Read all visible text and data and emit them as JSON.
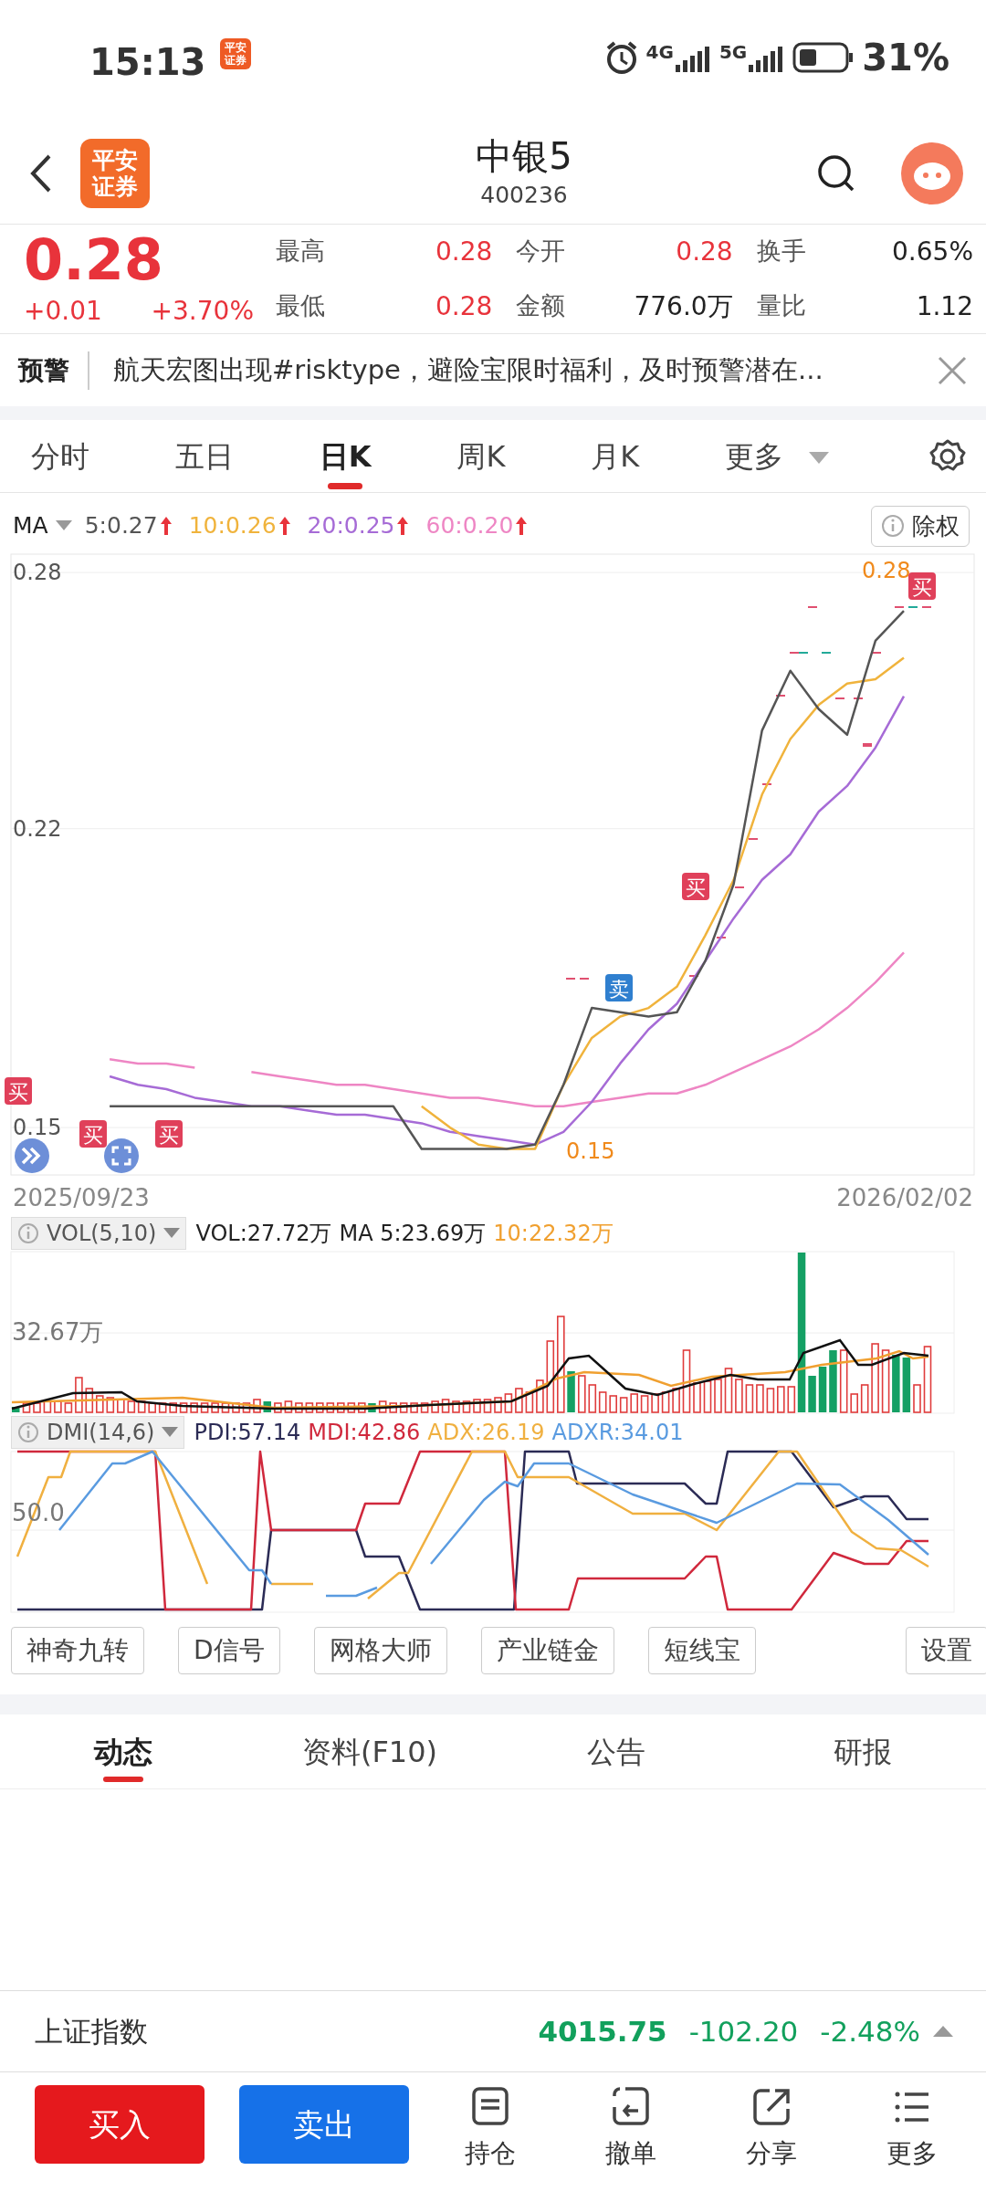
{
  "status_bar": {
    "time": "15:13",
    "app_badge": [
      "平安",
      "证券"
    ],
    "network_1": "4G",
    "network_2": "5G",
    "battery": "31%"
  },
  "header": {
    "logo": [
      "平安",
      "证券"
    ],
    "title": "中银5",
    "code": "400236"
  },
  "quote": {
    "price": "0.28",
    "change": "+0.01",
    "change_pct": "+3.70%",
    "stats": [
      {
        "label": "最高",
        "value": "0.28",
        "kind": "up"
      },
      {
        "label": "今开",
        "value": "0.28",
        "kind": "up"
      },
      {
        "label": "换手",
        "value": "0.65%",
        "kind": "plain"
      },
      {
        "label": "最低",
        "value": "0.28",
        "kind": "up"
      },
      {
        "label": "金额",
        "value": "776.0万",
        "kind": "plain"
      },
      {
        "label": "量比",
        "value": "1.12",
        "kind": "plain"
      }
    ]
  },
  "alert": {
    "label": "预警",
    "text": "航天宏图出现#risktype，避险宝限时福利，及时预警潜在..."
  },
  "period_tabs": [
    {
      "label": "分时",
      "selected": false,
      "kind": "plain"
    },
    {
      "label": "五日",
      "selected": false,
      "kind": "plain"
    },
    {
      "label": "日K",
      "selected": true,
      "kind": "plain"
    },
    {
      "label": "周K",
      "selected": false,
      "kind": "plain"
    },
    {
      "label": "月K",
      "selected": false,
      "kind": "plain"
    },
    {
      "label": "更多",
      "selected": false,
      "kind": "dropdown"
    }
  ],
  "ma_legend": {
    "label": "MA",
    "button": "除权",
    "items": [
      {
        "text": "5:0.27",
        "color": "#555555"
      },
      {
        "text": "10:0.26",
        "color": "#f0b33c"
      },
      {
        "text": "20:0.25",
        "color": "#a66bd6"
      },
      {
        "text": "60:0.20",
        "color": "#ee86c4"
      }
    ]
  },
  "price_chart": {
    "chart_data": {
      "type": "line",
      "categories": [
        "2025/09/23",
        null,
        null,
        null,
        null,
        null,
        null,
        null,
        null,
        null,
        null,
        null,
        null,
        null,
        null,
        null,
        null,
        null,
        null,
        null,
        null,
        null,
        null,
        null,
        null,
        null,
        null,
        null,
        null,
        "2026/02/02"
      ],
      "ylim": [
        0.1389,
        0.2843
      ],
      "yticks": [
        0.28,
        0.22,
        0.15
      ],
      "grid": true,
      "series": [
        {
          "color": "#ee86c4",
          "values": [
            null,
            0.166,
            0.165,
            0.165,
            0.164,
            null,
            0.163,
            0.162,
            0.161,
            0.16,
            0.16,
            0.159,
            0.158,
            0.157,
            0.157,
            0.156,
            0.155,
            0.155,
            0.156,
            0.157,
            0.158,
            0.158,
            0.16,
            0.163,
            0.166,
            0.169,
            0.173,
            0.178,
            0.184,
            0.191
          ]
        },
        {
          "color": "#a66bd6",
          "values": [
            null,
            0.162,
            0.16,
            0.159,
            0.157,
            0.156,
            0.155,
            0.155,
            0.154,
            0.153,
            0.153,
            0.152,
            0.151,
            0.149,
            0.148,
            0.147,
            0.146,
            0.149,
            0.156,
            0.165,
            0.173,
            0.179,
            0.189,
            0.199,
            0.208,
            0.214,
            0.224,
            0.23,
            0.239,
            0.251
          ]
        },
        {
          "color": "#f0b33c",
          "values": [
            null,
            null,
            null,
            null,
            null,
            null,
            null,
            null,
            null,
            null,
            null,
            null,
            0.155,
            0.15,
            0.146,
            0.145,
            0.145,
            0.16,
            0.171,
            0.176,
            0.178,
            0.183,
            0.195,
            0.208,
            0.228,
            0.241,
            0.249,
            0.254,
            0.255,
            0.26
          ]
        },
        {
          "color": "#555555",
          "values": [
            null,
            0.155,
            0.155,
            0.155,
            0.155,
            0.155,
            0.155,
            0.155,
            0.155,
            0.155,
            0.155,
            0.155,
            0.145,
            0.145,
            0.145,
            0.145,
            0.146,
            0.16,
            0.178,
            0.177,
            0.176,
            0.177,
            0.189,
            0.207,
            0.243,
            0.257,
            0.248,
            0.242,
            0.264,
            0.271
          ]
        }
      ]
    },
    "high_label": "0.28",
    "low_label": "0.15",
    "markers": [
      {
        "text": "买",
        "kind": "buy"
      },
      {
        "text": "买",
        "kind": "buy"
      },
      {
        "text": "买",
        "kind": "buy"
      },
      {
        "text": "卖",
        "kind": "sell"
      },
      {
        "text": "买",
        "kind": "buy"
      },
      {
        "text": "买",
        "kind": "buy"
      }
    ]
  },
  "volume": {
    "indicator": "VOL(5,10)",
    "y_label": "32.67万",
    "readings": [
      {
        "text": "VOL:27.72万",
        "color": "#222222"
      },
      {
        "text": "MA 5:23.69万",
        "color": "#222222"
      },
      {
        "text": "10:22.32万",
        "color": "#f0a030"
      }
    ]
  },
  "dmi": {
    "indicator": "DMI(14,6)",
    "y_label": "50.0",
    "readings": [
      {
        "text": "PDI:57.14",
        "color": "#2b2b55"
      },
      {
        "text": "MDI:42.86",
        "color": "#d0283c"
      },
      {
        "text": "ADX:26.19",
        "color": "#f0b040"
      },
      {
        "text": "ADXR:34.01",
        "color": "#5a9be0"
      }
    ]
  },
  "tools": [
    "神奇九转",
    "D信号",
    "网格大师",
    "产业链金",
    "短线宝",
    "设置"
  ],
  "info_tabs": [
    {
      "label": "动态",
      "selected": true
    },
    {
      "label": "资料(F10)",
      "selected": false
    },
    {
      "label": "公告",
      "selected": false
    },
    {
      "label": "研报",
      "selected": false
    }
  ],
  "index_bar": {
    "name": "上证指数",
    "value": "4015.75",
    "change": "-102.20",
    "change_pct": "-2.48%",
    "falling": true
  },
  "bottom_bar": {
    "buy": "买入",
    "sell": "卖出",
    "actions": [
      {
        "label": "持仓",
        "kind": "holdings"
      },
      {
        "label": "撤单",
        "kind": "cancel"
      },
      {
        "label": "分享",
        "kind": "share"
      },
      {
        "label": "更多",
        "kind": "more"
      }
    ]
  }
}
